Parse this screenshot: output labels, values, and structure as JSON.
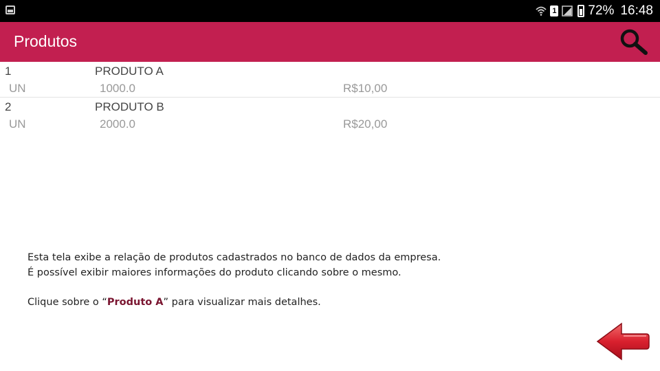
{
  "status_bar": {
    "battery": "72%",
    "time": "16:48",
    "sim": "1"
  },
  "app_bar": {
    "title": "Produtos"
  },
  "products": [
    {
      "code": "1",
      "name": "PRODUTO A",
      "unit": "UN",
      "quantity": "1000.0",
      "price": "R$10,00"
    },
    {
      "code": "2",
      "name": "PRODUTO B",
      "unit": "UN",
      "quantity": "2000.0",
      "price": "R$20,00"
    }
  ],
  "instructions": {
    "line1": "Esta tela exibe a relação de produtos cadastrados no banco de dados da empresa.",
    "line2": "É possível exibir maiores informações do produto clicando sobre o mesmo.",
    "line3_prefix": "Clique sobre o “",
    "line3_highlight": "Produto A",
    "line3_suffix": "” para visualizar mais detalhes."
  },
  "colors": {
    "app_bar": "#c21f50",
    "status_bar": "#000000",
    "back_arrow": "#d9202e"
  },
  "icons": [
    "gallery-icon",
    "wifi-icon",
    "sim-icon",
    "signal-icon",
    "battery-icon",
    "search-icon",
    "back-arrow-icon"
  ]
}
